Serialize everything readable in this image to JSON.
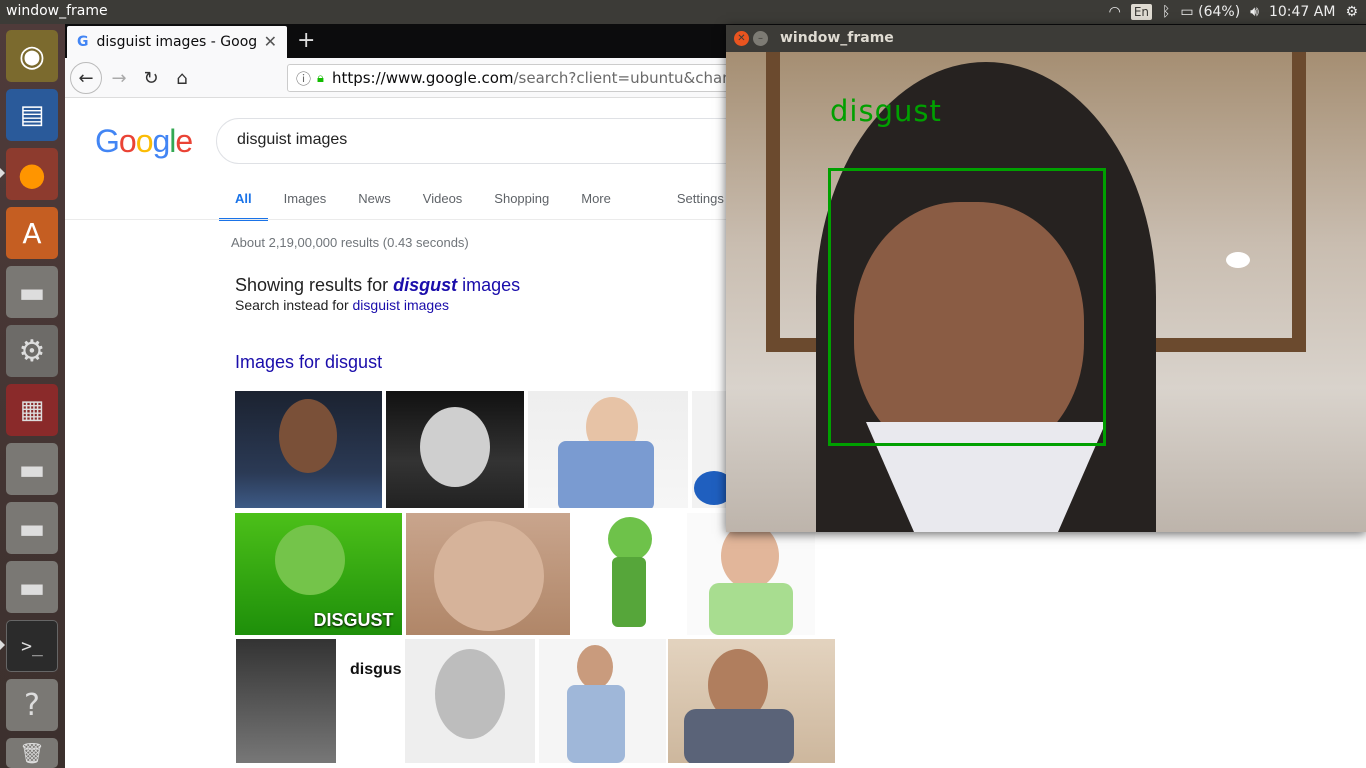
{
  "desktop": {
    "top_bar_title": "window_frame",
    "tray": {
      "lang": "En",
      "battery": "(64%)",
      "time": "10:47 AM"
    }
  },
  "launcher": [
    "ubuntu-dash",
    "libreoffice-writer",
    "firefox",
    "ubuntu-software",
    "drive",
    "system-settings",
    "files",
    "drive",
    "drive",
    "drive",
    "terminal",
    "help",
    "trash"
  ],
  "browser": {
    "tab_title": "disguist images - Google Search",
    "url_host": "https://www.google.com",
    "url_path": "/search?client=ubuntu&channel=fs&q=disguist+images"
  },
  "google": {
    "logo": "Google",
    "query": "disguist images",
    "tabs": [
      "All",
      "Images",
      "News",
      "Videos",
      "Shopping",
      "More",
      "Settings"
    ],
    "stats": "About 2,19,00,000 results (0.43 seconds)",
    "showing_prefix": "Showing results for ",
    "showing_bold": "disgust",
    "showing_suffix": " images",
    "instead_prefix": "Search instead for ",
    "instead_link": "disguist images",
    "images_heading": "Images for disgust",
    "thumb_caption": "DISGUST",
    "thumb_diagram_text": "disgus"
  },
  "cv_window": {
    "title": "window_frame",
    "emotion_label": "disgust",
    "box_color": "#00a000"
  }
}
